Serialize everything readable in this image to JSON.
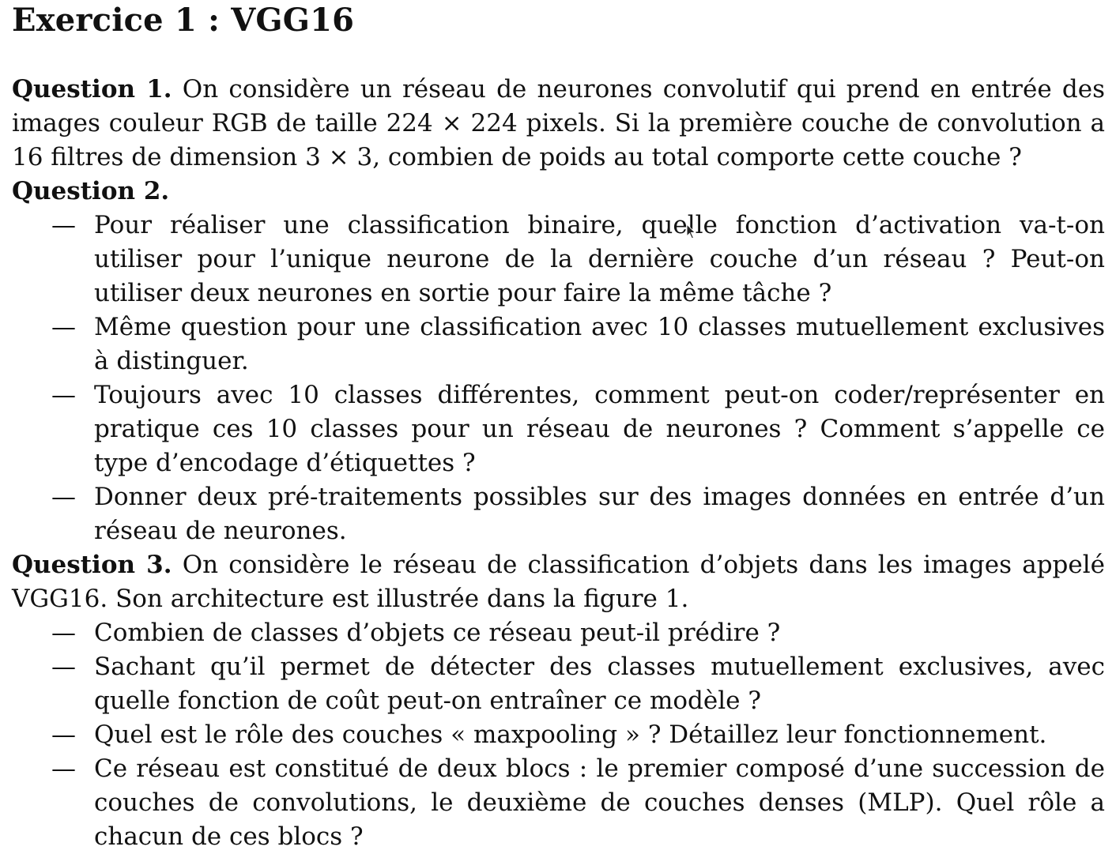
{
  "title": "Exercice 1 : VGG16",
  "questions": [
    {
      "label": "Question 1.",
      "intro": " On considère un réseau de neurones convolutif qui prend en entrée des images couleur RGB de taille 224 × 224 pixels. Si la première couche de convolution a 16 filtres de dimension 3 × 3, combien de poids au total comporte cette couche ?",
      "items": []
    },
    {
      "label": "Question 2.",
      "intro": "",
      "items": [
        "Pour réaliser une classification binaire, quelle fonction d’activation va-t-on utiliser pour l’unique neurone de la dernière couche d’un réseau ? Peut-on utiliser deux neurones en sortie pour faire la même tâche ?",
        "Même question pour une classification avec 10 classes mutuellement exclusives à distinguer.",
        "Toujours avec 10 classes différentes, comment peut-on coder/représenter en pratique ces 10 classes pour un réseau de neurones ? Comment s’appelle ce type d’encodage d’étiquettes ?",
        "Donner deux pré-traitements possibles sur des images données en entrée d’un réseau de neurones."
      ]
    },
    {
      "label": "Question 3.",
      "intro": " On considère le réseau de classification d’objets dans les images appelé VGG16. Son architecture est illustrée dans la figure 1.",
      "items": [
        "Combien de classes d’objets ce réseau peut-il prédire ?",
        "Sachant qu’il permet de détecter des classes mutuellement exclusives, avec quelle fonction de coût peut-on entraîner ce modèle ?",
        "Quel est le rôle des couches « maxpooling » ? Détaillez leur fonctionnement.",
        "Ce réseau est constitué de deux blocs : le premier composé d’une succession de couches de convolutions, le deuxième de couches denses (MLP). Quel rôle a chacun de ces blocs ?"
      ]
    }
  ],
  "dash_glyph": "—",
  "cursor_icon": "mouse-pointer-icon"
}
